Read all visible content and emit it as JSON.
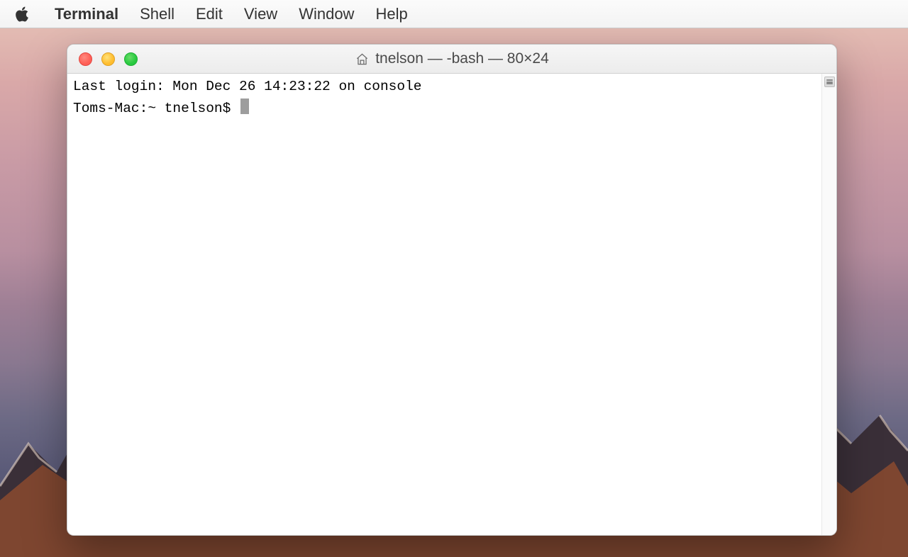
{
  "menubar": {
    "app_name": "Terminal",
    "items": [
      "Shell",
      "Edit",
      "View",
      "Window",
      "Help"
    ]
  },
  "window": {
    "title": "tnelson — -bash — 80×24",
    "icon": "home-icon"
  },
  "terminal": {
    "line1": "Last login: Mon Dec 26 14:23:22 on console",
    "prompt": "Toms-Mac:~ tnelson$ "
  },
  "colors": {
    "close": "#ff5f56",
    "minimize": "#ffbd2e",
    "maximize": "#27c93f"
  }
}
